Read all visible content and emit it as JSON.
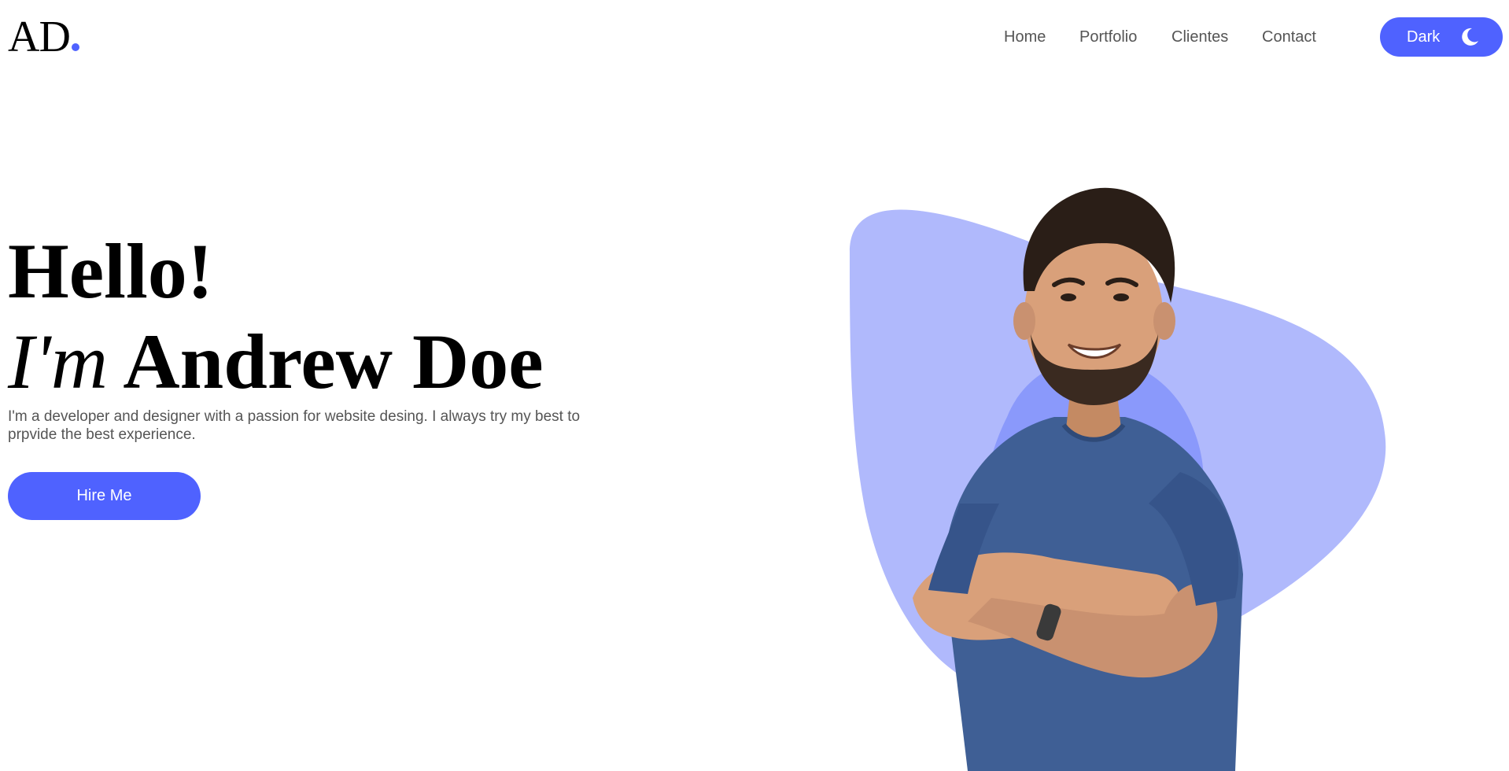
{
  "header": {
    "logo_text": "AD",
    "nav": [
      {
        "label": "Home"
      },
      {
        "label": "Portfolio"
      },
      {
        "label": "Clientes"
      },
      {
        "label": "Contact"
      }
    ],
    "theme_toggle": {
      "label": "Dark",
      "icon": "moon-icon"
    }
  },
  "hero": {
    "greeting": "Hello!",
    "im": "I'm",
    "name": "Andrew Doe",
    "intro": "I'm a developer and designer with a passion for website desing. I always try my best to prpvide the best experience.",
    "cta_label": "Hire Me"
  },
  "colors": {
    "accent": "#4f62ff",
    "blob_light": "#b0b9fc",
    "blob_dark": "#8a99fb",
    "shirt": "#3f5f95",
    "skin": "#d9a07a",
    "hair": "#2a1e17",
    "text_muted": "#555555"
  }
}
